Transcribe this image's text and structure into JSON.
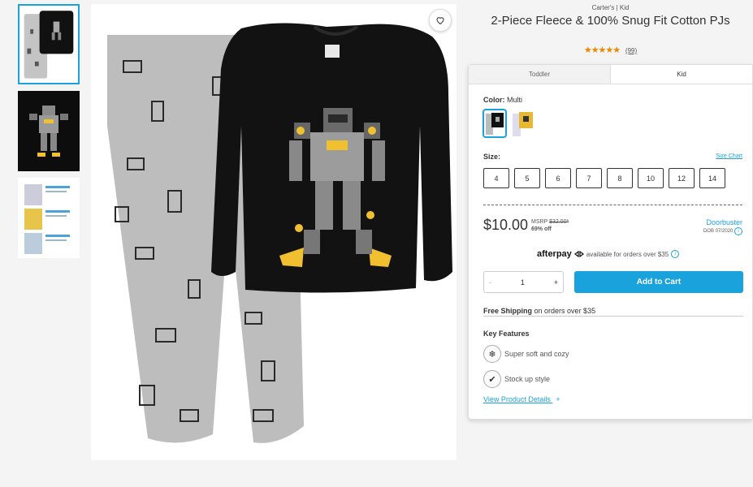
{
  "product": {
    "brand": "Carter's | Kid",
    "title": "2-Piece Fleece & 100% Snug Fit Cotton PJs",
    "stars": "★★★★★",
    "review_count": "(99)"
  },
  "tabs": [
    {
      "label": "Toddler",
      "active": false
    },
    {
      "label": "Kid",
      "active": true
    }
  ],
  "color": {
    "label": "Color:",
    "value": "Multi"
  },
  "size": {
    "label": "Size:",
    "chart_link": "Size Chart",
    "options": [
      "4",
      "5",
      "6",
      "7",
      "8",
      "10",
      "12",
      "14"
    ]
  },
  "pricing": {
    "price": "$10.00",
    "msrp_label": "MSRP",
    "msrp_value": "$32.00*",
    "discount": "69% off",
    "promo": "Doorbuster",
    "promo_date": "DOB 07/2020"
  },
  "afterpay": {
    "logo": "afterpay",
    "text": "available for orders over $35",
    "info": "i"
  },
  "cart": {
    "decrement": "-",
    "quantity": "1",
    "increment": "+",
    "add_label": "Add to Cart"
  },
  "shipping": {
    "bold": "Free Shipping",
    "text": "on orders over $35"
  },
  "features": {
    "title": "Key Features",
    "items": [
      {
        "label": "Super soft and cozy",
        "icon": "snowflake-icon"
      },
      {
        "label": "Stock up style",
        "icon": "check-icon"
      }
    ],
    "details_link": "View Product Details",
    "details_plus": "+"
  },
  "colors": {
    "accent": "#1aa2dc",
    "star": "#e68a00",
    "shirt": "#111111",
    "pants": "#bdbdbd"
  }
}
